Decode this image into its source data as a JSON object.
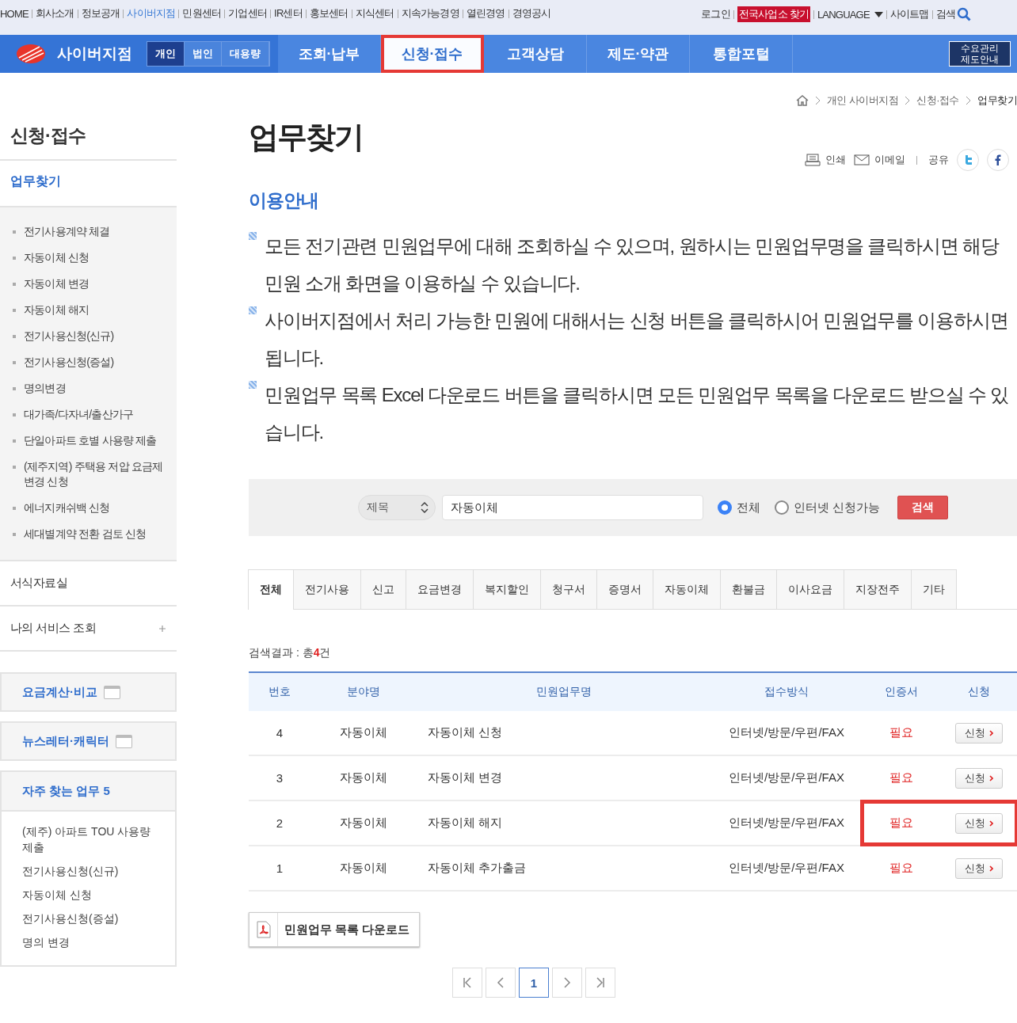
{
  "top_links": [
    {
      "label": "HOME",
      "selected": false
    },
    {
      "label": "회사소개",
      "selected": false
    },
    {
      "label": "정보공개",
      "selected": false
    },
    {
      "label": "사이버지점",
      "selected": true
    },
    {
      "label": "민원센터",
      "selected": false
    },
    {
      "label": "기업센터",
      "selected": false
    },
    {
      "label": "IR센터",
      "selected": false
    },
    {
      "label": "홍보센터",
      "selected": false
    },
    {
      "label": "지식센터",
      "selected": false
    },
    {
      "label": "지속가능경영",
      "selected": false
    },
    {
      "label": "열린경영",
      "selected": false
    },
    {
      "label": "경영공시",
      "selected": false
    }
  ],
  "util_links": [
    {
      "label": "로그인",
      "kind": "link"
    },
    {
      "label": "전국사업소 찾기",
      "kind": "badge"
    },
    {
      "label": "LANGUAGE",
      "kind": "dropdown"
    },
    {
      "label": "사이트맵",
      "kind": "link"
    },
    {
      "label": "검색",
      "kind": "search"
    }
  ],
  "brand": "사이버지점",
  "segments": [
    {
      "label": "개인",
      "selected": true
    },
    {
      "label": "법인",
      "selected": false
    },
    {
      "label": "대용량",
      "selected": false
    }
  ],
  "nav": [
    {
      "label": "조회·납부",
      "selected": false,
      "highlighted": false
    },
    {
      "label": "신청·접수",
      "selected": true,
      "highlighted": true
    },
    {
      "label": "고객상담",
      "selected": false,
      "highlighted": false
    },
    {
      "label": "제도·약관",
      "selected": false,
      "highlighted": false
    },
    {
      "label": "통합포털",
      "selected": false,
      "highlighted": false
    }
  ],
  "nav_side_button": [
    "수요관리",
    "제도안내"
  ],
  "breadcrumb": [
    "개인 사이버지점",
    "신청·접수",
    "업무찾기"
  ],
  "sidebar": {
    "title": "신청·접수",
    "current": "업무찾기",
    "sub_items": [
      "전기사용계약 체결",
      "자동이체 신청",
      "자동이체 변경",
      "자동이체 해지",
      "전기사용신청(신규)",
      "전기사용신청(증설)",
      "명의변경",
      "대가족/다자녀/출산가구",
      "단일아파트 호별 사용량 제출",
      "(제주지역) 주택용 저압 요금제 변경 신청",
      "에너지캐쉬백 신청",
      "세대별계약 전환 검토 신청"
    ],
    "menu": [
      {
        "label": "서식자료실",
        "expandable": false
      },
      {
        "label": "나의 서비스 조회",
        "expandable": true
      }
    ],
    "shortcuts": [
      "요금계산·비교",
      "뉴스레터·캐릭터"
    ],
    "frequent": {
      "title": "자주 찾는 업무 5",
      "items": [
        "(제주) 아파트 TOU 사용량 제출",
        "전기사용신청(신규)",
        "자동이체 신청",
        "전기사용신청(증설)",
        "명의 변경"
      ]
    }
  },
  "page_title": "업무찾기",
  "share": [
    {
      "label": "인쇄",
      "kind": "print"
    },
    {
      "label": "이메일",
      "kind": "email"
    },
    {
      "label": "공유",
      "kind": "text"
    },
    {
      "kind": "twitter"
    },
    {
      "kind": "facebook"
    }
  ],
  "section_title": "이용안내",
  "guide": [
    "모든 전기관련 민원업무에 대해 조회하실 수 있으며, 원하시는 민원업무명을 클릭하시면 해당 민원 소개 화면을 이용하실 수 있습니다.",
    "사이버지점에서 처리 가능한 민원에 대해서는 신청 버튼을 클릭하시어 민원업무를 이용하시면 됩니다.",
    "민원업무 목록 Excel 다운로드 버튼을 클릭하시면 모든 민원업무 목록을 다운로드 받으실 수 있습니다."
  ],
  "search": {
    "field": "제목",
    "value": "자동이체",
    "scope": [
      {
        "label": "전체",
        "selected": true
      },
      {
        "label": "인터넷 신청가능",
        "selected": false
      }
    ],
    "button": "검색"
  },
  "tabs": [
    {
      "label": "전체",
      "selected": true
    },
    {
      "label": "전기사용",
      "selected": false
    },
    {
      "label": "신고",
      "selected": false
    },
    {
      "label": "요금변경",
      "selected": false
    },
    {
      "label": "복지할인",
      "selected": false
    },
    {
      "label": "청구서",
      "selected": false
    },
    {
      "label": "증명서",
      "selected": false
    },
    {
      "label": "자동이체",
      "selected": false
    },
    {
      "label": "환불금",
      "selected": false
    },
    {
      "label": "이사요금",
      "selected": false
    },
    {
      "label": "지장전주",
      "selected": false
    },
    {
      "label": "기타",
      "selected": false
    }
  ],
  "result": "검색결과 : 총**4**건",
  "table": {
    "columns": [
      "번호",
      "분야명",
      "민원업무명",
      "접수방식",
      "인증서",
      "신청"
    ],
    "rows": [
      {
        "no": "4",
        "field": "자동이체",
        "name": "자동이체 신청",
        "method": "인터넷/방문/우편/FAX",
        "cert": "필요",
        "apply": "신청",
        "highlighted": false
      },
      {
        "no": "3",
        "field": "자동이체",
        "name": "자동이체 변경",
        "method": "인터넷/방문/우편/FAX",
        "cert": "필요",
        "apply": "신청",
        "highlighted": false
      },
      {
        "no": "2",
        "field": "자동이체",
        "name": "자동이체 해지",
        "method": "인터넷/방문/우편/FAX",
        "cert": "필요",
        "apply": "신청",
        "highlighted": true
      },
      {
        "no": "1",
        "field": "자동이체",
        "name": "자동이체 추가출금",
        "method": "인터넷/방문/우편/FAX",
        "cert": "필요",
        "apply": "신청",
        "highlighted": false
      }
    ]
  },
  "download": "민원업무 목록 다운로드",
  "pagination": [
    {
      "kind": "first"
    },
    {
      "kind": "prev"
    },
    {
      "kind": "page",
      "label": "1",
      "selected": true
    },
    {
      "kind": "next"
    },
    {
      "kind": "last"
    }
  ]
}
